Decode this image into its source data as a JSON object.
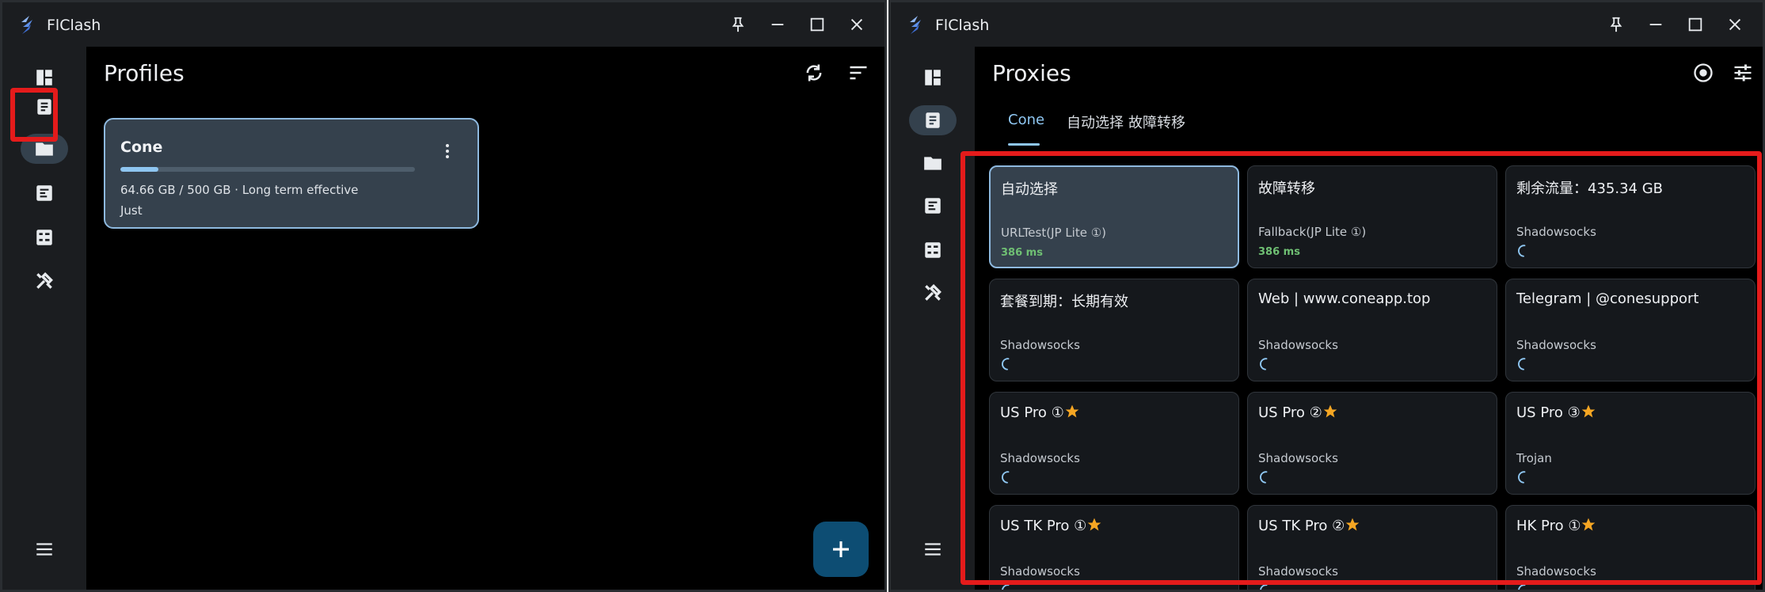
{
  "app": {
    "title": "FlClash",
    "colors": {
      "accent": "#8fc7f2",
      "rail_bg": "#1b1d20",
      "card": "#35414d",
      "highlight": "#e41b1b",
      "delay": "#6fbf73",
      "star": "#f5a623"
    }
  },
  "left_window": {
    "page_title": "Profiles",
    "header_icons": [
      "sync-icon",
      "sort-icon"
    ],
    "profile": {
      "name": "Cone",
      "usage_text": "64.66 GB / 500 GB · Long term effective",
      "usage_fraction": 0.129,
      "updated": "Just"
    },
    "rail_icons": [
      "dashboard-icon",
      "proxies-icon",
      "profiles-icon",
      "requests-icon",
      "connections-icon",
      "tools-icon",
      "menu-icon"
    ],
    "active_rail": "profiles"
  },
  "right_window": {
    "page_title": "Proxies",
    "header_icons": [
      "locate-icon",
      "tune-icon"
    ],
    "tabs": [
      {
        "label": "Cone"
      },
      {
        "label": "自动选择"
      },
      {
        "label": "故障转移"
      }
    ],
    "active_tab": 0,
    "proxies": [
      {
        "name": "自动选择",
        "type": "URLTest(JP Lite ①)",
        "delay": "386 ms",
        "star": false,
        "selected": true
      },
      {
        "name": "故障转移",
        "type": "Fallback(JP Lite ①)",
        "delay": "386 ms",
        "star": false,
        "selected": false
      },
      {
        "name": "剩余流量：435.34 GB",
        "type": "Shadowsocks",
        "delay": null,
        "star": false,
        "selected": false
      },
      {
        "name": "套餐到期：长期有效",
        "type": "Shadowsocks",
        "delay": null,
        "star": false,
        "selected": false
      },
      {
        "name": "Web | www.coneapp.top",
        "type": "Shadowsocks",
        "delay": null,
        "star": false,
        "selected": false
      },
      {
        "name": "Telegram | @conesupport",
        "type": "Shadowsocks",
        "delay": null,
        "star": false,
        "selected": false
      },
      {
        "name": "US Pro ①",
        "type": "Shadowsocks",
        "delay": null,
        "star": true,
        "selected": false
      },
      {
        "name": "US Pro ②",
        "type": "Shadowsocks",
        "delay": null,
        "star": true,
        "selected": false
      },
      {
        "name": "US Pro ③",
        "type": "Trojan",
        "delay": null,
        "star": true,
        "selected": false
      },
      {
        "name": "US TK Pro ①",
        "type": "Shadowsocks",
        "delay": null,
        "star": true,
        "selected": false
      },
      {
        "name": "US TK Pro ②",
        "type": "Shadowsocks",
        "delay": null,
        "star": true,
        "selected": false
      },
      {
        "name": "HK Pro ①",
        "type": "Shadowsocks",
        "delay": null,
        "star": true,
        "selected": false
      }
    ],
    "active_rail": "proxies"
  }
}
